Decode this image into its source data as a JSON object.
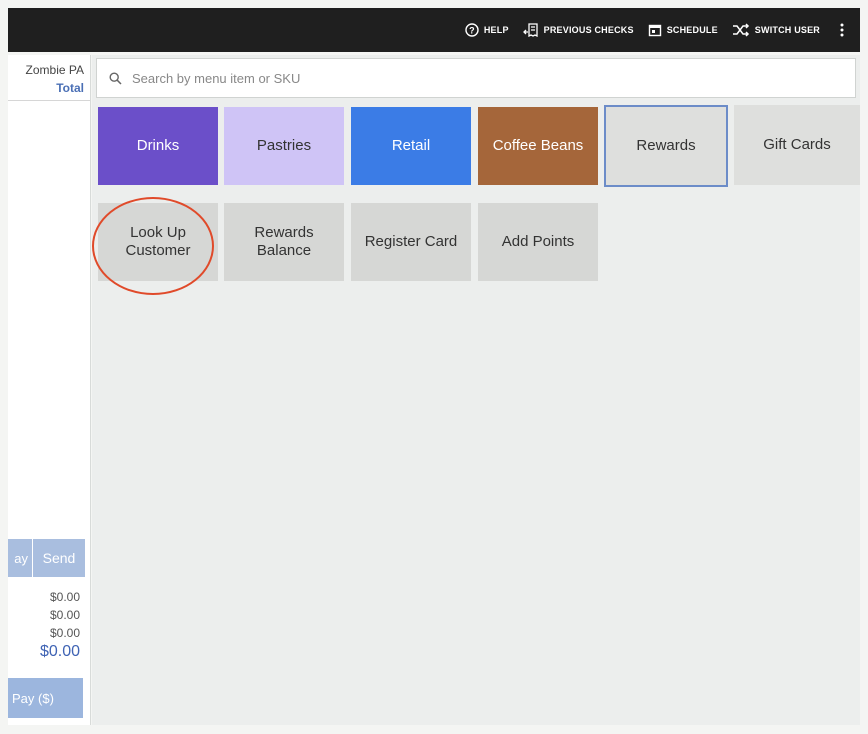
{
  "topbar": {
    "help_label": "HELP",
    "previous_checks_label": "PREVIOUS CHECKS",
    "schedule_label": "SCHEDULE",
    "switch_user_label": "SWITCH USER"
  },
  "ticket": {
    "item_name": "Zombie PA",
    "total_header": "Total",
    "left_button_label": "ay",
    "send_label": "Send",
    "amounts": [
      "$0.00",
      "$0.00",
      "$0.00"
    ],
    "grand_total": "$0.00",
    "pay_label": "Pay ($)"
  },
  "search": {
    "placeholder": "Search by menu item or SKU"
  },
  "categories": [
    {
      "label": "Drinks",
      "color": "#6b4fc9"
    },
    {
      "label": "Pastries",
      "color": "#cfc4f6"
    },
    {
      "label": "Retail",
      "color": "#3b7ce6"
    },
    {
      "label": "Coffee Beans",
      "color": "#a5663a"
    },
    {
      "label": "Rewards",
      "color": "#dedfdd",
      "selected": true
    },
    {
      "label": "Gift Cards",
      "color": "#dedfdd"
    }
  ],
  "reward_actions": [
    {
      "label": "Look Up\nCustomer"
    },
    {
      "label": "Rewards\nBalance"
    },
    {
      "label": "Register Card"
    },
    {
      "label": "Add Points"
    }
  ],
  "colors": {
    "accent": "#3f63b4",
    "highlight_circle": "#e04a2a"
  }
}
